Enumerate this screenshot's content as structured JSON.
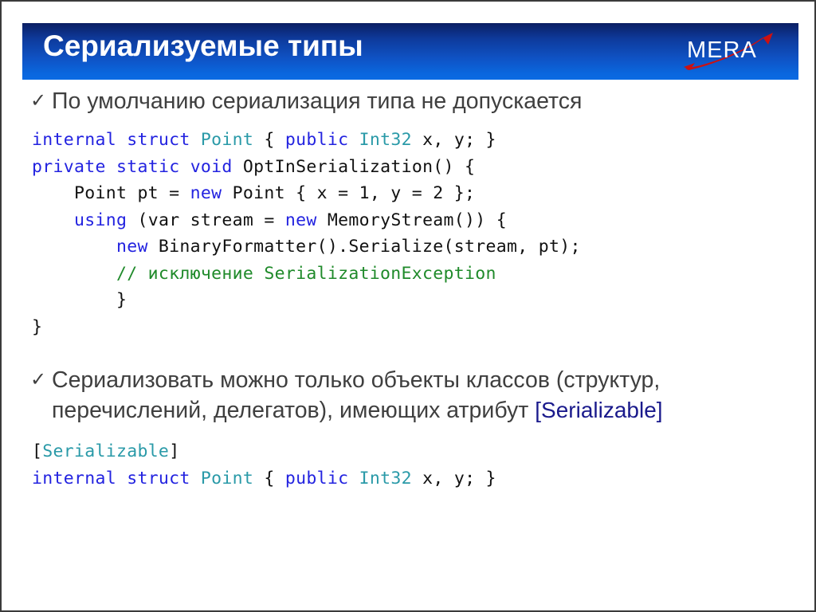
{
  "slide": {
    "title": "Сериализуемые типы",
    "logo_text": "MERA",
    "header_gradient_top": "#0b1f63",
    "header_gradient_bottom": "#0a6be4",
    "logo_swoosh_color": "#cc1111"
  },
  "bullets": [
    {
      "marker": "✓",
      "text": "По умолчанию сериализация типа не допускается"
    },
    {
      "marker": "✓",
      "text": "Сериализовать можно только объекты классов (структур, перечислений, делегатов), имеющих атрибут ",
      "attribute": "[Serializable]"
    }
  ],
  "code_block_1": {
    "lines": [
      [
        {
          "t": "internal",
          "c": "kw"
        },
        {
          "t": " ",
          "c": "pun"
        },
        {
          "t": "struct",
          "c": "kw"
        },
        {
          "t": " ",
          "c": "pun"
        },
        {
          "t": "Point",
          "c": "type"
        },
        {
          "t": " { ",
          "c": "pun"
        },
        {
          "t": "public",
          "c": "kw"
        },
        {
          "t": " ",
          "c": "pun"
        },
        {
          "t": "Int32",
          "c": "type"
        },
        {
          "t": " x, y; }",
          "c": "pun"
        }
      ],
      [
        {
          "t": "private",
          "c": "kw"
        },
        {
          "t": " ",
          "c": "pun"
        },
        {
          "t": "static",
          "c": "kw"
        },
        {
          "t": " ",
          "c": "pun"
        },
        {
          "t": "void",
          "c": "kw"
        },
        {
          "t": " OptInSerialization() {",
          "c": "pun"
        }
      ],
      [
        {
          "t": "    Point pt = ",
          "c": "pun"
        },
        {
          "t": "new",
          "c": "kw"
        },
        {
          "t": " Point { x = 1, y = 2 };",
          "c": "pun"
        }
      ],
      [
        {
          "t": "    ",
          "c": "pun"
        },
        {
          "t": "using",
          "c": "kw"
        },
        {
          "t": " (var stream = ",
          "c": "pun"
        },
        {
          "t": "new",
          "c": "kw"
        },
        {
          "t": " MemoryStream()) {",
          "c": "pun"
        }
      ],
      [
        {
          "t": "        ",
          "c": "pun"
        },
        {
          "t": "new",
          "c": "kw"
        },
        {
          "t": " BinaryFormatter().Serialize(stream, pt);",
          "c": "pun"
        }
      ],
      [
        {
          "t": "        // исключение SerializationException",
          "c": "cmt"
        }
      ],
      [
        {
          "t": "        }",
          "c": "pun"
        }
      ],
      [
        {
          "t": "}",
          "c": "pun"
        }
      ]
    ]
  },
  "code_block_2": {
    "lines": [
      [
        {
          "t": "[",
          "c": "pun"
        },
        {
          "t": "Serializable",
          "c": "type"
        },
        {
          "t": "]",
          "c": "pun"
        }
      ],
      [
        {
          "t": "internal",
          "c": "kw"
        },
        {
          "t": " ",
          "c": "pun"
        },
        {
          "t": "struct",
          "c": "kw"
        },
        {
          "t": " ",
          "c": "pun"
        },
        {
          "t": "Point",
          "c": "type"
        },
        {
          "t": " { ",
          "c": "pun"
        },
        {
          "t": "public",
          "c": "kw"
        },
        {
          "t": " ",
          "c": "pun"
        },
        {
          "t": "Int32",
          "c": "type"
        },
        {
          "t": " x, y; }",
          "c": "pun"
        }
      ]
    ]
  }
}
